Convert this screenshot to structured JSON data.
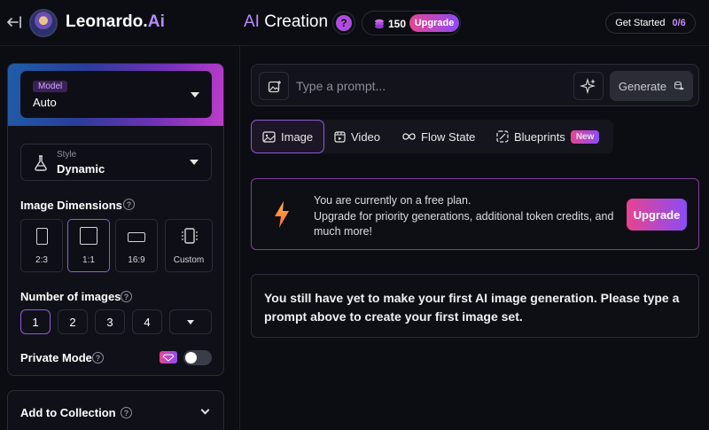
{
  "header": {
    "brand_name": "Leonardo.",
    "brand_suffix": "Ai",
    "title_prefix": "AI",
    "title_rest": " Creation",
    "help_glyph": "?",
    "token_count": "150",
    "upgrade_label": "Upgrade",
    "get_started_label": "Get Started",
    "get_started_count": "0/6"
  },
  "sidebar": {
    "model_tag": "Model",
    "model_value": "Auto",
    "style_label": "Style",
    "style_value": "Dynamic",
    "dimensions_label": "Image Dimensions",
    "dimensions": [
      {
        "label": "2:3"
      },
      {
        "label": "1:1",
        "selected": true
      },
      {
        "label": "16:9"
      },
      {
        "label": "Custom"
      }
    ],
    "number_label": "Number of images",
    "numbers": [
      "1",
      "2",
      "3",
      "4"
    ],
    "number_selected": "1",
    "private_mode_label": "Private Mode",
    "private_mode_on": false,
    "collection_label": "Add to Collection"
  },
  "prompt": {
    "placeholder": "Type a prompt...",
    "generate_label": "Generate"
  },
  "tabs": [
    {
      "label": "Image",
      "active": true
    },
    {
      "label": "Video"
    },
    {
      "label": "Flow State"
    },
    {
      "label": "Blueprints",
      "badge": "New"
    }
  ],
  "notice": {
    "line1": "You are currently on a free plan.",
    "line2": "Upgrade for priority generations, additional token credits, and much more!",
    "button_label": "Upgrade"
  },
  "empty_state": {
    "message": "You still have yet to make your first AI image generation. Please type a prompt above to create your first image set."
  },
  "colors": {
    "accent_purple": "#b58cff",
    "upgrade_gradient_start": "#e74591",
    "upgrade_gradient_end": "#8c4cf5",
    "background": "#0c0d12"
  }
}
